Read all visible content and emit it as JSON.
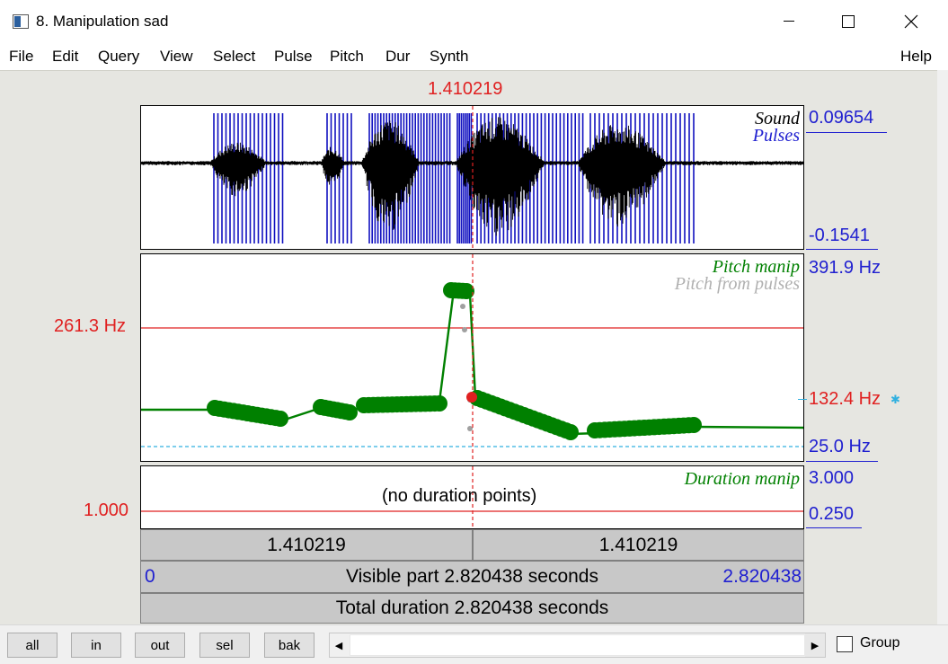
{
  "window": {
    "title": "8. Manipulation sad"
  },
  "menu": {
    "items": [
      "File",
      "Edit",
      "Query",
      "View",
      "Select",
      "Pulse",
      "Pitch",
      "Dur",
      "Synth"
    ],
    "help": "Help"
  },
  "cursor": {
    "time_label": "1.410219"
  },
  "sound_panel": {
    "label_sound": "Sound",
    "label_pulses": "Pulses",
    "ymax": "0.09654",
    "ymin": "-0.1541"
  },
  "pitch_panel": {
    "label_manip": "Pitch manip",
    "label_from_pulses": "Pitch from pulses",
    "ymax": "391.9 Hz",
    "ymin": "25.0 Hz",
    "cursor_value": "132.4 Hz",
    "hline_value": "261.3 Hz"
  },
  "duration_panel": {
    "label": "Duration manip",
    "empty_text": "(no duration points)",
    "ymax": "3.000",
    "ymin": "0.250",
    "hline_value": "1.000"
  },
  "time_bars": {
    "left_segment": "1.410219",
    "right_segment": "1.410219",
    "visible_start": "0",
    "visible_text": "Visible part 2.820438 seconds",
    "visible_end": "2.820438",
    "total_text": "Total duration 2.820438 seconds"
  },
  "bottom": {
    "buttons": [
      "all",
      "in",
      "out",
      "sel",
      "bak"
    ],
    "group_label": "Group",
    "group_checked": false
  },
  "colors": {
    "cursor_red": "#e02020",
    "axis_blue": "#2020d0",
    "pitch_green": "#008000",
    "pulse_blue": "#1010c0"
  }
}
